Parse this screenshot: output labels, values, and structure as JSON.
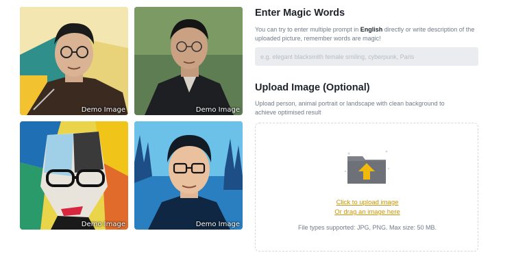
{
  "gallery": {
    "items": [
      {
        "caption": "Demo Image"
      },
      {
        "caption": "Demo Image"
      },
      {
        "caption": "Demo Image"
      },
      {
        "caption": "Demo Image"
      }
    ]
  },
  "magic": {
    "title": "Enter Magic Words",
    "desc_before": "You can try to enter multiple prompt in ",
    "desc_bold": "English",
    "desc_after": " directly or write description of the uploaded picture, remember words are magic!",
    "placeholder": "e.g. elegant blacksmith female smiling, cyberpunk, Paris"
  },
  "upload": {
    "title": "Upload Image (Optional)",
    "desc": "Upload person, animal portrait or landscape with clean background to achieve optimised result",
    "click_label": "Click to upload image",
    "drag_label": "Or drag an image here",
    "file_types": "File types supported: JPG, PNG. Max size: 50 MB.",
    "icon": "folder-upload-icon"
  },
  "colors": {
    "accent": "#c99400",
    "folder": "#7d8087",
    "arrow": "#f0b90b",
    "input_bg": "#eaecef"
  }
}
